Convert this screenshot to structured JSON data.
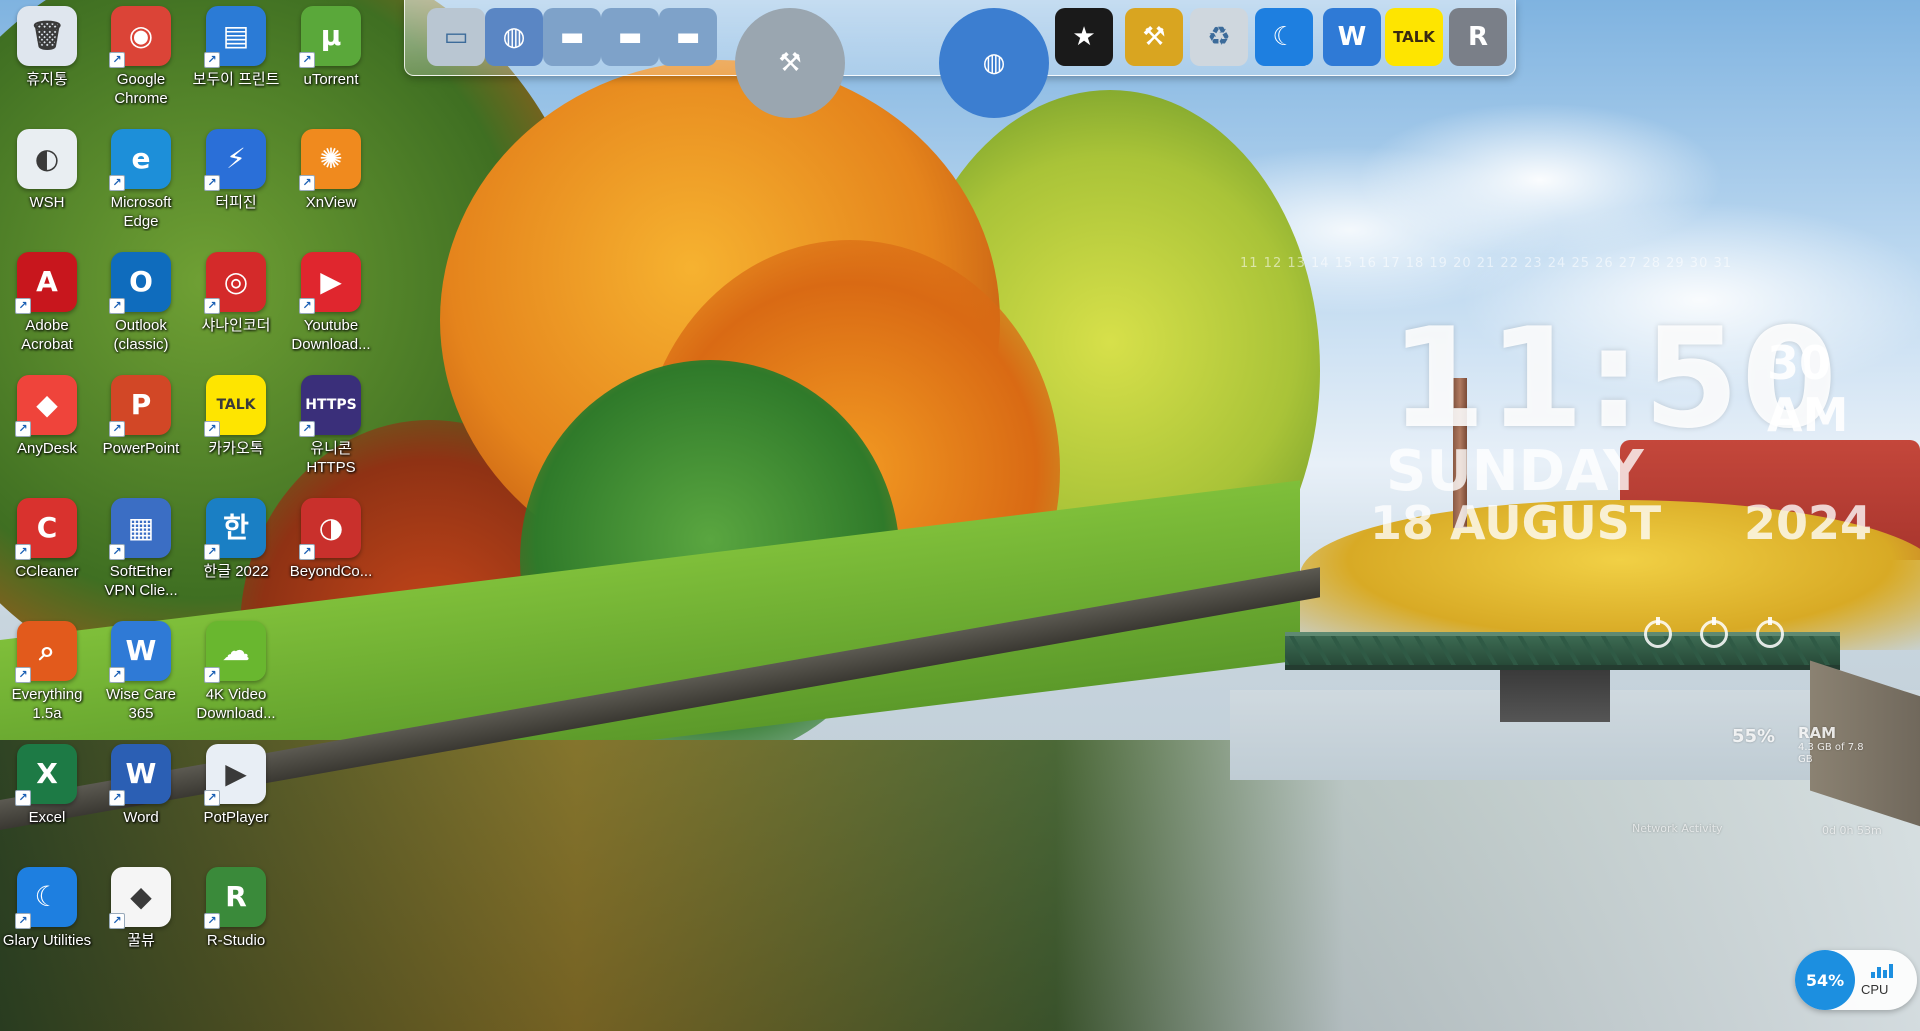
{
  "desktop_icons": [
    {
      "label": "휴지통",
      "icon": "recycle-bin-icon",
      "color": "#dfe6ee",
      "glyph": "🗑",
      "shortcut": false
    },
    {
      "label": "Google Chrome",
      "icon": "chrome-icon",
      "color": "#db4437",
      "glyph": "◉",
      "shortcut": true
    },
    {
      "label": "보두이 프린트",
      "icon": "printer-app-icon",
      "color": "#2b7bd6",
      "glyph": "▤",
      "shortcut": true
    },
    {
      "label": "uTorrent",
      "icon": "utorrent-icon",
      "color": "#5aa83a",
      "glyph": "µ",
      "shortcut": true
    },
    {
      "label": "WSH",
      "icon": "script-file-icon",
      "color": "#e9eef2",
      "glyph": "◐",
      "shortcut": false
    },
    {
      "label": "Microsoft Edge",
      "icon": "edge-icon",
      "color": "#1d8fd9",
      "glyph": "e",
      "shortcut": true
    },
    {
      "label": "터피진",
      "icon": "lightning-app-icon",
      "color": "#2a6fd8",
      "glyph": "⚡",
      "shortcut": true
    },
    {
      "label": "XnView",
      "icon": "xnview-icon",
      "color": "#f08a1e",
      "glyph": "✺",
      "shortcut": true
    },
    {
      "label": "Adobe Acrobat",
      "icon": "acrobat-icon",
      "color": "#c8161d",
      "glyph": "A",
      "shortcut": true
    },
    {
      "label": "Outlook (classic)",
      "icon": "outlook-icon",
      "color": "#0f6cbd",
      "glyph": "O",
      "shortcut": true
    },
    {
      "label": "샤나인코더",
      "icon": "shana-encoder-icon",
      "color": "#d42a2a",
      "glyph": "◎",
      "shortcut": true
    },
    {
      "label": "Youtube Download...",
      "icon": "youtube-downloader-icon",
      "color": "#e0262e",
      "glyph": "▶",
      "shortcut": true
    },
    {
      "label": "AnyDesk",
      "icon": "anydesk-icon",
      "color": "#ef443b",
      "glyph": "◆",
      "shortcut": true
    },
    {
      "label": "PowerPoint",
      "icon": "powerpoint-icon",
      "color": "#d24726",
      "glyph": "P",
      "shortcut": true
    },
    {
      "label": "카카오톡",
      "icon": "kakaotalk-icon",
      "color": "#fee500",
      "glyph": "TALK",
      "shortcut": true
    },
    {
      "label": "유니콘 HTTPS",
      "icon": "unicorn-https-icon",
      "color": "#3a2f7a",
      "glyph": "HTTPS",
      "shortcut": true
    },
    {
      "label": "CCleaner",
      "icon": "ccleaner-icon",
      "color": "#d9322e",
      "glyph": "C",
      "shortcut": true
    },
    {
      "label": "SoftEther VPN Clie...",
      "icon": "softether-vpn-icon",
      "color": "#3b6ec4",
      "glyph": "▦",
      "shortcut": true
    },
    {
      "label": "한글 2022",
      "icon": "hangul-icon",
      "color": "#1a7fc4",
      "glyph": "한",
      "shortcut": true
    },
    {
      "label": "BeyondCo...",
      "icon": "beyond-compare-icon",
      "color": "#c9302c",
      "glyph": "◑",
      "shortcut": true
    },
    {
      "label": "Everything 1.5a",
      "icon": "everything-search-icon",
      "color": "#e25a1c",
      "glyph": "⌕",
      "shortcut": true
    },
    {
      "label": "Wise Care 365",
      "icon": "wise-care-icon",
      "color": "#2f7ad6",
      "glyph": "W",
      "shortcut": true
    },
    {
      "label": "4K Video Download...",
      "icon": "4k-video-downloader-icon",
      "color": "#69b72f",
      "glyph": "☁",
      "shortcut": true
    },
    {
      "label": "",
      "icon": "empty-slot",
      "color": "",
      "glyph": "",
      "shortcut": false
    },
    {
      "label": "Excel",
      "icon": "excel-icon",
      "color": "#1d7a45",
      "glyph": "X",
      "shortcut": true
    },
    {
      "label": "Word",
      "icon": "word-icon",
      "color": "#2b5fb4",
      "glyph": "W",
      "shortcut": true
    },
    {
      "label": "PotPlayer",
      "icon": "potplayer-icon",
      "color": "#e8eef5",
      "glyph": "▶",
      "shortcut": true
    },
    {
      "label": "",
      "icon": "empty-slot",
      "color": "",
      "glyph": "",
      "shortcut": false
    },
    {
      "label": "Glary Utilities",
      "icon": "glary-utilities-icon",
      "color": "#1e7fe0",
      "glyph": "☾",
      "shortcut": true
    },
    {
      "label": "꿀뷰",
      "icon": "honeyview-icon",
      "color": "#f5f5f5",
      "glyph": "◆",
      "shortcut": true
    },
    {
      "label": "R-Studio",
      "icon": "r-studio-icon",
      "color": "#3a8a3a",
      "glyph": "R",
      "shortcut": true
    }
  ],
  "dock": {
    "items": [
      {
        "icon": "computer-icon",
        "color": "#b9c6d2",
        "glyph": "▭"
      },
      {
        "icon": "network-globe-icon",
        "color": "#5a86c4",
        "glyph": "◍"
      },
      {
        "icon": "folder-documents-icon",
        "color": "#7ea2c9",
        "glyph": "▬"
      },
      {
        "icon": "folder-downloads-icon",
        "color": "#7ea2c9",
        "glyph": "▬"
      },
      {
        "icon": "folder-pictures-icon",
        "color": "#7ea2c9",
        "glyph": "▬"
      },
      {
        "icon": "tools-hammer-icon",
        "color": "#9aa6b0",
        "glyph": "⚒"
      },
      {
        "icon": "internet-globe-icon",
        "color": "#3c7ed0",
        "glyph": "◍"
      },
      {
        "icon": "tshirt-icon",
        "color": "#1a1a1a",
        "glyph": "★"
      },
      {
        "icon": "repair-tools-icon",
        "color": "#d9a520",
        "glyph": "⚒"
      },
      {
        "icon": "trash-icon",
        "color": "#cfd7de",
        "glyph": "♻"
      },
      {
        "icon": "glary-moon-icon",
        "color": "#1e7fe0",
        "glyph": "☾"
      },
      {
        "icon": "wise-shield-icon",
        "color": "#2f7ad6",
        "glyph": "W"
      },
      {
        "icon": "kakaotalk-dock-icon",
        "color": "#fee500",
        "glyph": "TALK"
      },
      {
        "icon": "r-studio-dock-icon",
        "color": "#7a7f88",
        "glyph": "R"
      }
    ]
  },
  "clock": {
    "time": "11:50",
    "seconds": "30",
    "ampm": "AM",
    "day": "SUNDAY",
    "date": "18 AUGUST",
    "year": "2024",
    "days_strip": "11 12 13 14 15 16 17 18 19 20 21 22 23 24 25 26 27 28 29 30 31"
  },
  "system": {
    "ram_percent": "55%",
    "ram_label": "RAM",
    "ram_detail": "4.3 GB of 7.8 GB",
    "network_label": "Network Activity",
    "uptime_label": "0d 0h 53m",
    "cpu_percent": "54%",
    "cpu_label": "CPU"
  },
  "colors": {
    "cpu_accent": "#1c8fe0",
    "label_text": "#ffffff"
  }
}
